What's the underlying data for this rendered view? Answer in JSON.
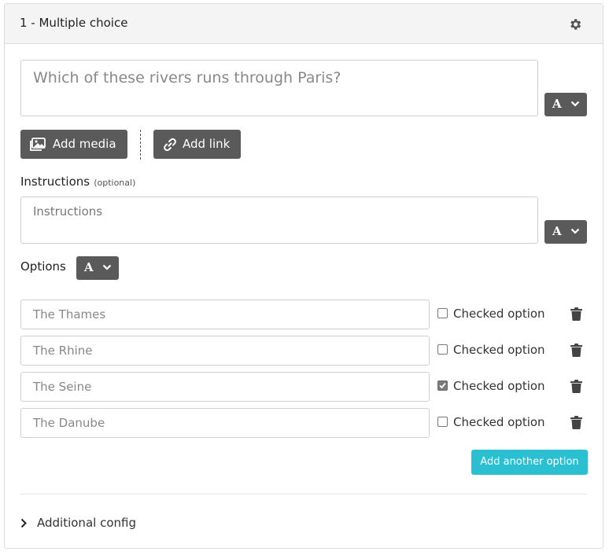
{
  "header": {
    "title": "1 - Multiple choice",
    "settings_icon": "gear-icon"
  },
  "question": {
    "placeholder": "Which of these rivers runs through Paris?",
    "format_label": "A"
  },
  "media": {
    "add_media_label": "Add media",
    "add_link_label": "Add link"
  },
  "instructions": {
    "label": "Instructions",
    "optional_label": "(optional)",
    "placeholder": "Instructions",
    "format_label": "A"
  },
  "options": {
    "label": "Options",
    "format_label": "A",
    "checked_label": "Checked option",
    "items": [
      {
        "text": "The Thames",
        "checked": false
      },
      {
        "text": "The Rhine",
        "checked": false
      },
      {
        "text": "The Seine",
        "checked": true
      },
      {
        "text": "The Danube",
        "checked": false
      }
    ],
    "add_label": "Add another option"
  },
  "additional": {
    "label": "Additional config"
  },
  "colors": {
    "accent": "#2bc0d1",
    "dark_button": "#5a5a5a",
    "header_bg": "#f4f4f4"
  }
}
